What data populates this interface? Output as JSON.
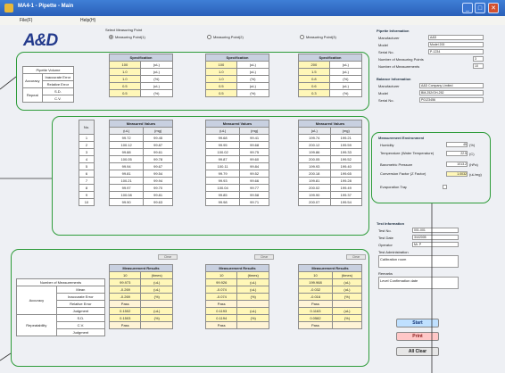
{
  "titlebar": {
    "title": "MA4-1 - Pipette - Main"
  },
  "menu": {
    "items": [
      "File(F)",
      "Help(H)"
    ]
  },
  "logo": {
    "text": "A&D"
  },
  "measuring_points": {
    "label": "Select Measuring Point",
    "options": [
      "Measuring Point(1)",
      "Measuring Point(2)",
      "Measuring Point(3)"
    ],
    "selected_index": 0
  },
  "spec": {
    "row_labels": [
      "Pipette Volume",
      "Accuracy (%)",
      "Relative Error",
      "Repeatability"
    ],
    "left_labels": [
      "Pipette Volume",
      "Accuracy",
      "Inaccurate Error",
      "Relative Error",
      "Repeat",
      "S.D.",
      "C.V."
    ],
    "header": "Specification",
    "columns": [
      {
        "rows": [
          [
            "100",
            "(uL)"
          ],
          [
            "1.0",
            "(uL)"
          ],
          [
            "1.0",
            "(%)"
          ],
          [
            "0.5",
            "(uL)"
          ],
          [
            "0.5",
            "(%)"
          ]
        ]
      },
      {
        "rows": [
          [
            "100",
            "(uL)"
          ],
          [
            "1.0",
            "(uL)"
          ],
          [
            "1.0",
            "(%)"
          ],
          [
            "0.5",
            "(uL)"
          ],
          [
            "0.5",
            "(%)"
          ]
        ]
      },
      {
        "rows": [
          [
            "200",
            "(uL)"
          ],
          [
            "1.5",
            "(uL)"
          ],
          [
            "0.8",
            "(%)"
          ],
          [
            "0.6",
            "(uL)"
          ],
          [
            "0.3",
            "(%)"
          ]
        ]
      }
    ]
  },
  "measured": {
    "no_label": "No.",
    "header": "Measured Values",
    "sub_headers": [
      "(uL)",
      "(mg)"
    ],
    "numbers": [
      "1",
      "2",
      "3",
      "4",
      "5",
      "6",
      "7",
      "8",
      "9",
      "10"
    ],
    "columns": [
      {
        "rows": [
          [
            "99.72",
            "99.45"
          ],
          [
            "100.12",
            "99.87"
          ],
          [
            "99.88",
            "99.61"
          ],
          [
            "100.05",
            "99.78"
          ],
          [
            "99.94",
            "99.67"
          ],
          [
            "99.81",
            "99.54"
          ],
          [
            "100.21",
            "99.94"
          ],
          [
            "99.97",
            "99.70"
          ],
          [
            "100.08",
            "99.81"
          ],
          [
            "99.90",
            "99.63"
          ]
        ]
      },
      {
        "rows": [
          [
            "99.68",
            "99.41"
          ],
          [
            "99.95",
            "99.68"
          ],
          [
            "100.02",
            "99.75"
          ],
          [
            "99.87",
            "99.60"
          ],
          [
            "100.11",
            "99.84"
          ],
          [
            "99.79",
            "99.52"
          ],
          [
            "99.93",
            "99.66"
          ],
          [
            "100.04",
            "99.77"
          ],
          [
            "99.85",
            "99.58"
          ],
          [
            "99.98",
            "99.71"
          ]
        ]
      },
      {
        "rows": [
          [
            "199.74",
            "199.21"
          ],
          [
            "200.12",
            "199.59"
          ],
          [
            "199.86",
            "199.33"
          ],
          [
            "200.05",
            "199.52"
          ],
          [
            "199.93",
            "199.40"
          ],
          [
            "200.18",
            "199.65"
          ],
          [
            "199.81",
            "199.28"
          ],
          [
            "200.02",
            "199.49"
          ],
          [
            "199.90",
            "199.37"
          ],
          [
            "200.07",
            "199.54"
          ]
        ]
      }
    ]
  },
  "results": {
    "clear_label": "Clear",
    "header": "Measurement Results",
    "left_rows": [
      [
        "Number of Measurements",
        ""
      ],
      [
        "Accuracy",
        "Mean"
      ],
      [
        "",
        "Inaccurate Error"
      ],
      [
        "",
        "Relative Error"
      ],
      [
        "",
        "Judgment"
      ],
      [
        "Repeatability",
        "S.D."
      ],
      [
        "",
        "C.V."
      ],
      [
        "",
        "Judgment"
      ]
    ],
    "columns": [
      {
        "rows": [
          [
            "10",
            "(times)"
          ],
          [
            "99.973",
            "(uL)"
          ],
          [
            "-0.269",
            "(uL)"
          ],
          [
            "-0.269",
            "(%)"
          ],
          [
            "Pass",
            ""
          ],
          [
            "0.1502",
            "(uL)"
          ],
          [
            "0.1503",
            "(%)"
          ],
          [
            "Pass",
            ""
          ]
        ]
      },
      {
        "rows": [
          [
            "10",
            "(times)"
          ],
          [
            "99.926",
            "(uL)"
          ],
          [
            "-0.074",
            "(uL)"
          ],
          [
            "-0.074",
            "(%)"
          ],
          [
            "Pass",
            ""
          ],
          [
            "0.1193",
            "(uL)"
          ],
          [
            "0.1194",
            "(%)"
          ],
          [
            "Pass",
            ""
          ]
        ]
      },
      {
        "rows": [
          [
            "10",
            "(times)"
          ],
          [
            "199.968",
            "(uL)"
          ],
          [
            "-0.032",
            "(uL)"
          ],
          [
            "-0.016",
            "(%)"
          ],
          [
            "Pass",
            ""
          ],
          [
            "0.1163",
            "(uL)"
          ],
          [
            "0.0582",
            "(%)"
          ],
          [
            "Pass",
            ""
          ]
        ]
      }
    ]
  },
  "pipette_info": {
    "title": "Pipette Information",
    "rows": [
      [
        "Manufacturer",
        "A&D"
      ],
      [
        "Model",
        "Model 200"
      ],
      [
        "Serial No.",
        "P-1234"
      ],
      [
        "Number of Measuring Points",
        "3"
      ],
      [
        "Number of Measurements",
        "10"
      ]
    ]
  },
  "balance_info": {
    "title": "Balance Information",
    "rows": [
      [
        "Manufacturer",
        "A&D Company Limited"
      ],
      [
        "Model",
        "BM-252/GH-252"
      ],
      [
        "Serial No.",
        "P0123456"
      ]
    ]
  },
  "environment": {
    "title": "Measurement Environment",
    "rows": [
      [
        "Humidity",
        "45",
        "(%)"
      ],
      [
        "Temperature (Water Temperature)",
        "22.5",
        "(C)"
      ],
      [
        "Barometric Pressure",
        "1013.2",
        "(hPa)"
      ],
      [
        "Conversion Factor (Z Factor)",
        "1.0032",
        "(uL/mg)"
      ],
      [
        "Evaporation Trap",
        "",
        ""
      ]
    ]
  },
  "test_info": {
    "title": "Test Information",
    "rows": [
      [
        "Test No.",
        "001-001"
      ],
      [
        "Test Date",
        "3/4/2005"
      ],
      [
        "Operator",
        "Mr. P"
      ]
    ],
    "test_admin_label": "Test Administration",
    "test_admin_value": "Calibration room",
    "remarks_label": "Remarks",
    "remarks_value": "Level Confirmation date"
  },
  "buttons": {
    "start": "Start",
    "print": "Print",
    "all_clear": "All Clear"
  },
  "colors": {
    "frame": "#2e9c3a",
    "title_blue": "#2a5fb8",
    "header": "#c8d0e0",
    "yellow": "#fff7b8"
  }
}
